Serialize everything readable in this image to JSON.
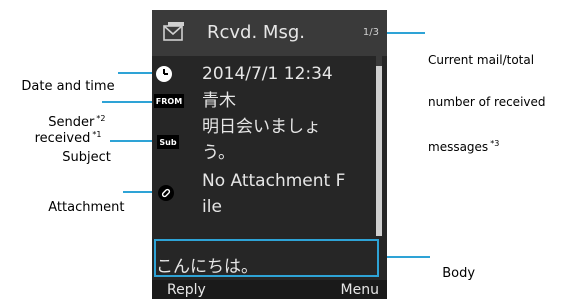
{
  "callouts": {
    "date_time_line1": "Date and time",
    "date_time_line2": "received",
    "date_time_note": "*1",
    "sender": "Sender",
    "sender_note": "*2",
    "subject": "Subject",
    "attachment": "Attachment",
    "current_line1": "Current mail/total",
    "current_line2": "number of received",
    "current_line3": "messages",
    "current_note": "*3",
    "body": "Body"
  },
  "screen": {
    "title": "Rcvd. Msg.",
    "counter": "1/3",
    "date_time": "2014/7/1 12:34",
    "from_badge": "FROM",
    "sender_name": "青木",
    "sub_badge": "Sub",
    "subject_line1": "明日会いましょ",
    "subject_line2": "う。",
    "attachment_line1": "No Attachment F",
    "attachment_line2": "ile",
    "body_text": "こんにちは。",
    "reply_key": "Reply",
    "menu_key": "Menu"
  },
  "colors": {
    "screen_bg": "#262626",
    "highlight": "#2ea3d6",
    "callout_line": "#2ea3d6"
  }
}
